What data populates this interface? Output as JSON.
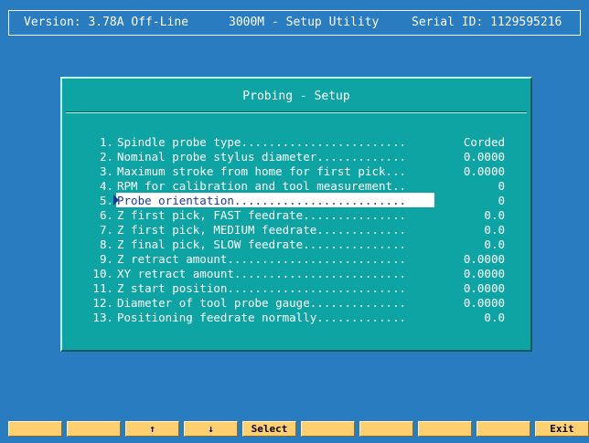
{
  "header": {
    "version": "Version: 3.78A Off-Line",
    "app_title": "3000M - Setup Utility",
    "serial": "Serial ID: 1129595216"
  },
  "dialog": {
    "title": "Probing - Setup",
    "items": [
      {
        "num": "1.",
        "label": "Spindle probe type........................",
        "value": "Corded"
      },
      {
        "num": "2.",
        "label": "Nominal probe stylus diameter.............",
        "value": "0.0000"
      },
      {
        "num": "3.",
        "label": "Maximum stroke from home for first pick...",
        "value": "0.0000"
      },
      {
        "num": "4.",
        "label": "RPM for calibration and tool measurement..",
        "value": "0"
      },
      {
        "num": "5.",
        "label": "Probe orientation.........................",
        "value": "0"
      },
      {
        "num": "6.",
        "label": "Z first pick, FAST feedrate...............",
        "value": "0.0"
      },
      {
        "num": "7.",
        "label": "Z first pick, MEDIUM feedrate.............",
        "value": "0.0"
      },
      {
        "num": "8.",
        "label": "Z final pick, SLOW feedrate...............",
        "value": "0.0"
      },
      {
        "num": "9.",
        "label": "Z retract amount..........................",
        "value": "0.0000"
      },
      {
        "num": "10.",
        "label": "XY retract amount.........................",
        "value": "0.0000"
      },
      {
        "num": "11.",
        "label": "Z start position..........................",
        "value": "0.0000"
      },
      {
        "num": "12.",
        "label": "Diameter of tool probe gauge..............",
        "value": "0.0000"
      },
      {
        "num": "13.",
        "label": "Positioning feedrate normally.............",
        "value": "0.0"
      }
    ],
    "selected_index": 4
  },
  "function_keys": [
    "",
    "",
    "↑",
    "↓",
    "Select",
    "",
    "",
    "",
    "",
    "Exit"
  ]
}
